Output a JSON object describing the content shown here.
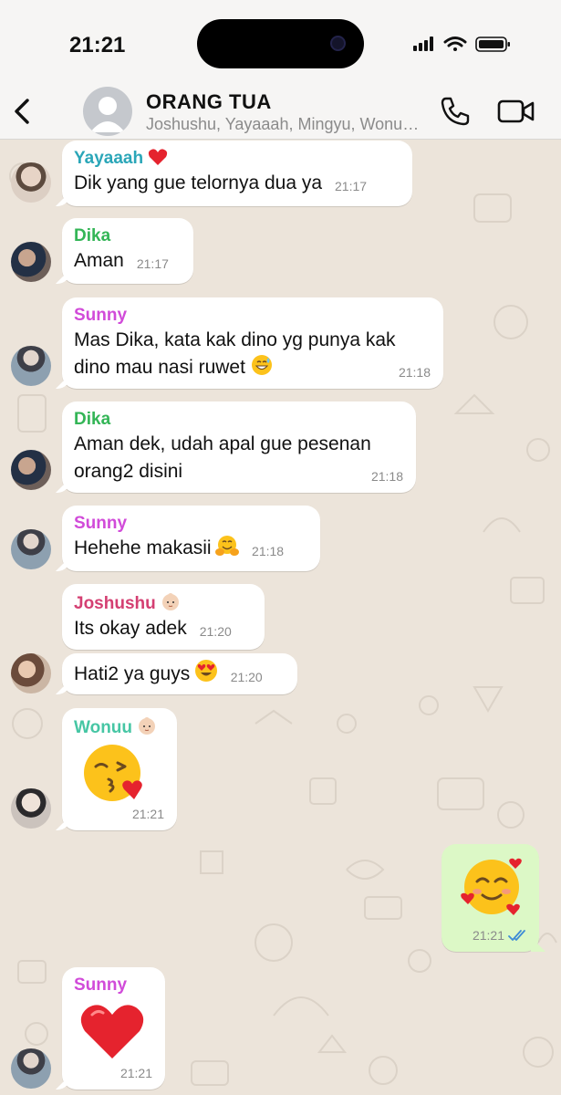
{
  "status_bar": {
    "time": "21:21"
  },
  "header": {
    "title": "ORANG TUA",
    "members": "Joshushu, Yayaaah, Mingyu, Wonuu, Dika, Sunny"
  },
  "colors": {
    "yayaaah": "#2aa6b8",
    "dika": "#33b556",
    "sunny": "#d14bd9",
    "joshushu": "#d43f72",
    "wonuu": "#46c6a4",
    "outgoing_bubble": "#dcf8c6",
    "read_ticks": "#3d8bd6"
  },
  "messages": [
    {
      "sender": "Yayaaah",
      "sender_emoji": "red-heart",
      "text": "Dik yang gue telornya dua ya",
      "time": "21:17"
    },
    {
      "sender": "Dika",
      "text": "Aman",
      "time": "21:17"
    },
    {
      "sender": "Sunny",
      "text_line1": "Mas Dika, kata kak dino yg punya kak",
      "text_line2": "dino mau nasi ruwet",
      "text_emoji": "grinning-sweat",
      "time": "21:18"
    },
    {
      "sender": "Dika",
      "text_line1": "Aman dek, udah apal gue pesenan",
      "text_line2": "orang2 disini",
      "time": "21:18"
    },
    {
      "sender": "Sunny",
      "text": "Hehehe makasii",
      "text_emoji": "hugging-face",
      "time": "21:18"
    },
    {
      "sender": "Joshushu",
      "sender_emoji": "baby",
      "text": "Its okay adek",
      "time": "21:20"
    },
    {
      "sender": "",
      "text": "Hati2 ya guys",
      "text_emoji": "heart-eyes",
      "time": "21:20"
    },
    {
      "sender": "Wonuu",
      "sender_emoji": "baby",
      "sticker": "kissing-heart-emoji",
      "time": "21:21"
    },
    {
      "outgoing": true,
      "sticker": "smiling-hearts-emoji",
      "time": "21:21",
      "read": true
    },
    {
      "sender": "Sunny",
      "sticker": "red-heart-emoji",
      "time": "21:21"
    }
  ]
}
